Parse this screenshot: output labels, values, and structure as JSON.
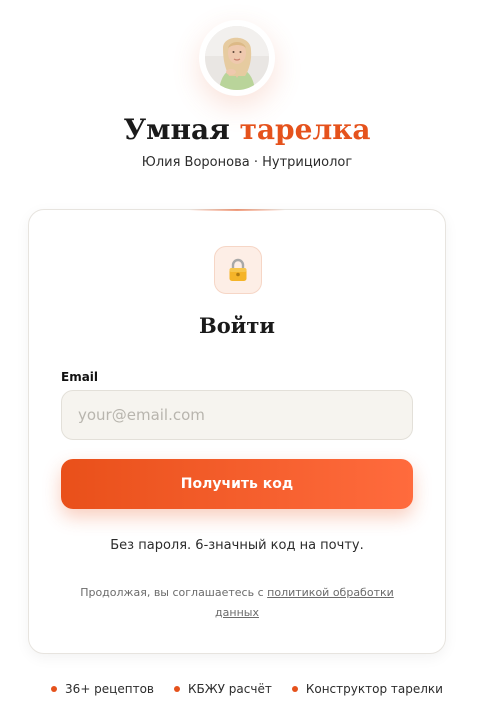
{
  "brand": {
    "title_part1": "Умная",
    "title_part2": "тарелка",
    "subtitle": "Юлия Воронова · Нутрициолог",
    "accent_color": "#e5521c"
  },
  "avatar": {
    "icon": "author-avatar-photo"
  },
  "login": {
    "lock_icon": "lock-icon",
    "title": "Войти",
    "email_label": "Email",
    "email_placeholder": "your@email.com",
    "email_value": "",
    "submit_label": "Получить код",
    "hint": "Без пароля. 6-значный код на почту.",
    "terms_prefix": "Продолжая, вы соглашаетесь с ",
    "terms_link": "политикой обработки данных"
  },
  "features": [
    "36+ рецептов",
    "КБЖУ расчёт",
    "Конструктор тарелки"
  ]
}
